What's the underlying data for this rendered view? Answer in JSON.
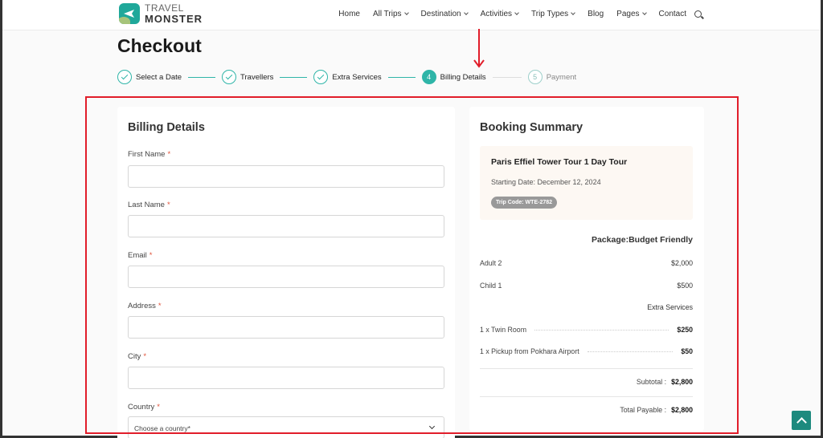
{
  "header": {
    "logo_top": "TRAVEL",
    "logo_bottom": "MONSTER",
    "nav": [
      "Home",
      "All Trips",
      "Destination",
      "Activities",
      "Trip Types",
      "Blog",
      "Pages",
      "Contact"
    ]
  },
  "page": {
    "title": "Checkout"
  },
  "steps": [
    {
      "label": "Select a Date",
      "state": "done"
    },
    {
      "label": "Travellers",
      "state": "done"
    },
    {
      "label": "Extra Services",
      "state": "done"
    },
    {
      "label": "Billing Details",
      "number": "4",
      "state": "active"
    },
    {
      "label": "Payment",
      "number": "5",
      "state": "pending"
    }
  ],
  "billing": {
    "title": "Billing Details",
    "fields": {
      "first_name": "First Name",
      "last_name": "Last Name",
      "email": "Email",
      "address": "Address",
      "city": "City",
      "country": "Country"
    },
    "required_mark": "*",
    "country_placeholder": "Choose a country*"
  },
  "summary": {
    "title": "Booking Summary",
    "trip_name": "Paris Effiel Tower Tour 1 Day Tour",
    "starting_date": "Starting Date: December 12, 2024",
    "trip_code": "Trip Code: WTE-2782",
    "package": "Package:Budget Friendly",
    "lines": [
      {
        "label": "Adult 2",
        "value": "$2,000"
      },
      {
        "label": "Child 1",
        "value": "$500"
      }
    ],
    "extra_services_label": "Extra Services",
    "extras": [
      {
        "label": "1 x Twin Room",
        "value": "$250"
      },
      {
        "label": "1 x Pickup from Pokhara Airport",
        "value": "$50"
      }
    ],
    "subtotal_label": "Subtotal :",
    "subtotal_value": "$2,800",
    "total_label": "Total Payable :",
    "total_value": "$2,800"
  },
  "colors": {
    "accent": "#2fb5a8",
    "highlight": "#e11d2a",
    "required": "#e0523a"
  }
}
